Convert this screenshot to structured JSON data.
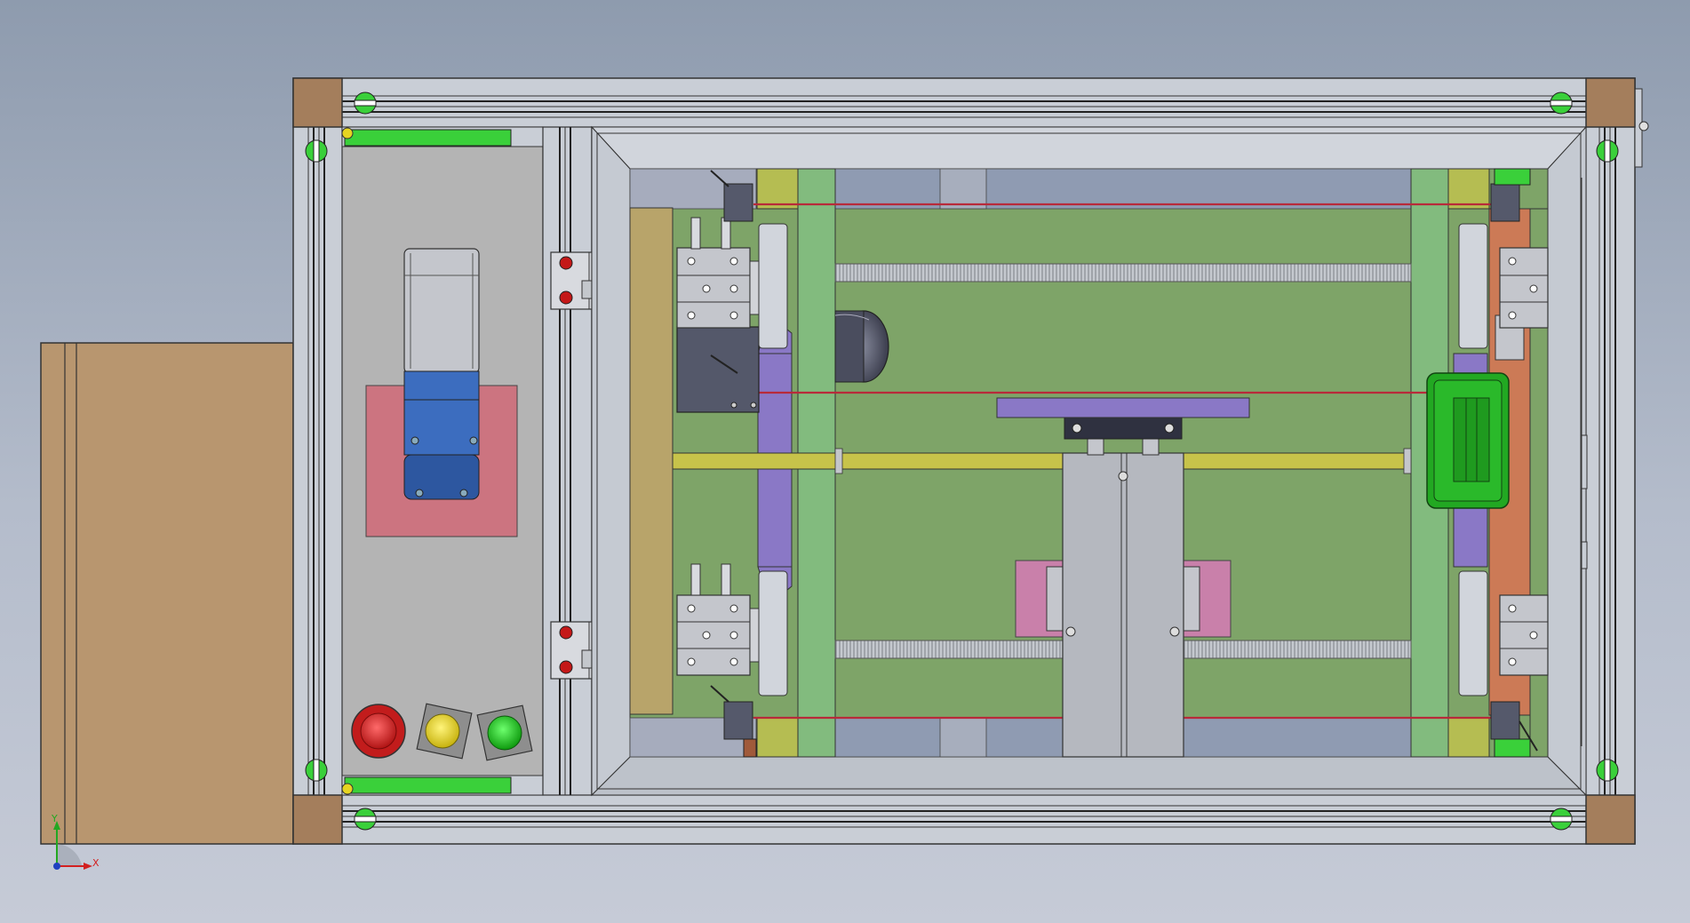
{
  "colors": {
    "background_top": "#8e9bae",
    "background_bottom": "#c6cbd7",
    "frame_aluminum": "#c9ced6",
    "corner_bracket": "#a47e5c",
    "side_cabinet": "#b8966f",
    "control_panel": "#b4b4b4",
    "work_area": "#7ea468",
    "green_rail": "#82bb7e",
    "purple_plate": "#8a78c6",
    "motor_blue": "#3c6dbf",
    "pink_pad": "#cc7480",
    "olive_plate": "#b8a46a",
    "orange_plate": "#cc7a56",
    "green_box": "#22a822",
    "estop_red": "#d42a2a",
    "button_yellow": "#e6d422",
    "button_green": "#22c422",
    "axis_x": "#d22020",
    "axis_y": "#22a822",
    "axis_z": "#2040c0"
  },
  "icons": {
    "emergency_stop": "estop-icon",
    "yellow_button": "yellow-button-icon",
    "green_button": "green-button-icon",
    "triad": "axis-triad-icon"
  },
  "triad": {
    "x_label": "X",
    "y_label": "Y"
  }
}
